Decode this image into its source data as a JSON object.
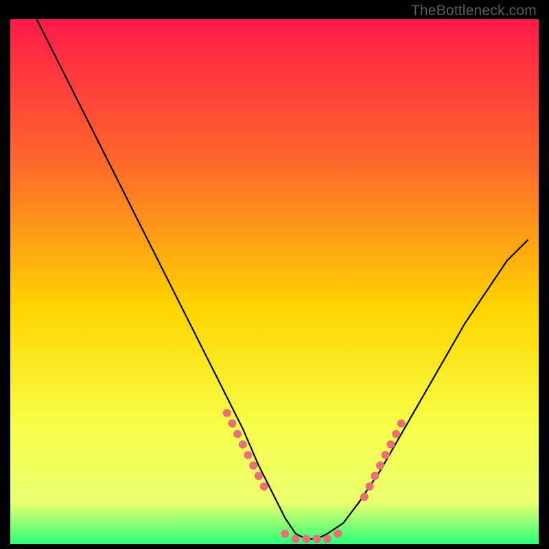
{
  "watermark": "TheBottleneck.com",
  "colors": {
    "gradient_top": "#ff1a4b",
    "gradient_mid_upper": "#ff6a2a",
    "gradient_mid": "#ffd400",
    "gradient_lower": "#f6ff4a",
    "gradient_bottom_yellow": "#ecff70",
    "gradient_green": "#2aff7a",
    "curve": "#000000",
    "dots": "#e96f78",
    "frame": "#000000"
  },
  "chart_data": {
    "type": "line",
    "title": "",
    "xlabel": "",
    "ylabel": "",
    "xlim": [
      0,
      100
    ],
    "ylim": [
      0,
      100
    ],
    "series": [
      {
        "name": "bottleneck-curve",
        "x": [
          5,
          8,
          12,
          16,
          20,
          24,
          28,
          32,
          36,
          40,
          44,
          47,
          50,
          52,
          54,
          56,
          58,
          60,
          63,
          66,
          70,
          74,
          78,
          82,
          86,
          90,
          94,
          98
        ],
        "y": [
          100,
          94,
          86,
          78,
          70,
          62,
          54,
          46,
          38,
          30,
          22,
          15,
          9,
          5,
          2,
          1,
          1,
          2,
          4,
          8,
          14,
          21,
          28,
          35,
          42,
          48,
          54,
          58
        ]
      }
    ],
    "dot_clusters": [
      {
        "name": "left-slope-dots",
        "points": [
          [
            41,
            25
          ],
          [
            42,
            23
          ],
          [
            43,
            21
          ],
          [
            44,
            19
          ],
          [
            45,
            17
          ],
          [
            46,
            15
          ],
          [
            47,
            13
          ],
          [
            48,
            11
          ]
        ]
      },
      {
        "name": "valley-dots",
        "points": [
          [
            52,
            2
          ],
          [
            54,
            1
          ],
          [
            56,
            1
          ],
          [
            58,
            1
          ],
          [
            60,
            1
          ],
          [
            62,
            2
          ]
        ]
      },
      {
        "name": "right-slope-dots",
        "points": [
          [
            67,
            9
          ],
          [
            68,
            11
          ],
          [
            69,
            13
          ],
          [
            70,
            15
          ],
          [
            71,
            17
          ],
          [
            72,
            19
          ],
          [
            73,
            21
          ],
          [
            74,
            23
          ]
        ]
      }
    ]
  }
}
